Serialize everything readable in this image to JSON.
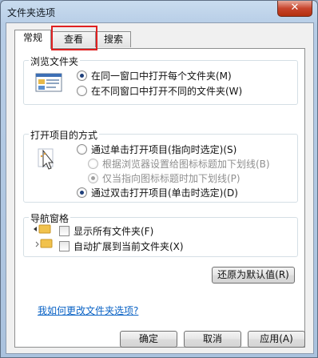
{
  "window": {
    "title": "文件夹选项",
    "close_label": "✕"
  },
  "tabs": [
    {
      "label": "常规",
      "active": true
    },
    {
      "label": "查看",
      "active": false,
      "highlighted": true
    },
    {
      "label": "搜索",
      "active": false
    }
  ],
  "browse_folders": {
    "title": "浏览文件夹",
    "options": [
      {
        "label": "在同一窗口中打开每个文件夹(M)",
        "selected": true
      },
      {
        "label": "在不同窗口中打开不同的文件夹(W)",
        "selected": false
      }
    ]
  },
  "click_items": {
    "title": "打开项目的方式",
    "options": [
      {
        "label": "通过单击打开项目(指向时选定)(S)",
        "selected": false,
        "enabled": true
      },
      {
        "label": "根据浏览器设置给图标标题加下划线(B)",
        "selected": false,
        "enabled": false
      },
      {
        "label": "仅当指向图标标题时加下划线(P)",
        "selected": true,
        "enabled": false
      },
      {
        "label": "通过双击打开项目(单击时选定)(D)",
        "selected": true,
        "enabled": true
      }
    ]
  },
  "navigation_pane": {
    "title": "导航窗格",
    "options": [
      {
        "label": "显示所有文件夹(F)",
        "checked": false
      },
      {
        "label": "自动扩展到当前文件夹(X)",
        "checked": false
      }
    ]
  },
  "restore_defaults_label": "还原为默认值(R)",
  "help_link": "我如何更改文件夹选项?",
  "buttons": {
    "ok": "确定",
    "cancel": "取消",
    "apply": "应用(A)"
  }
}
